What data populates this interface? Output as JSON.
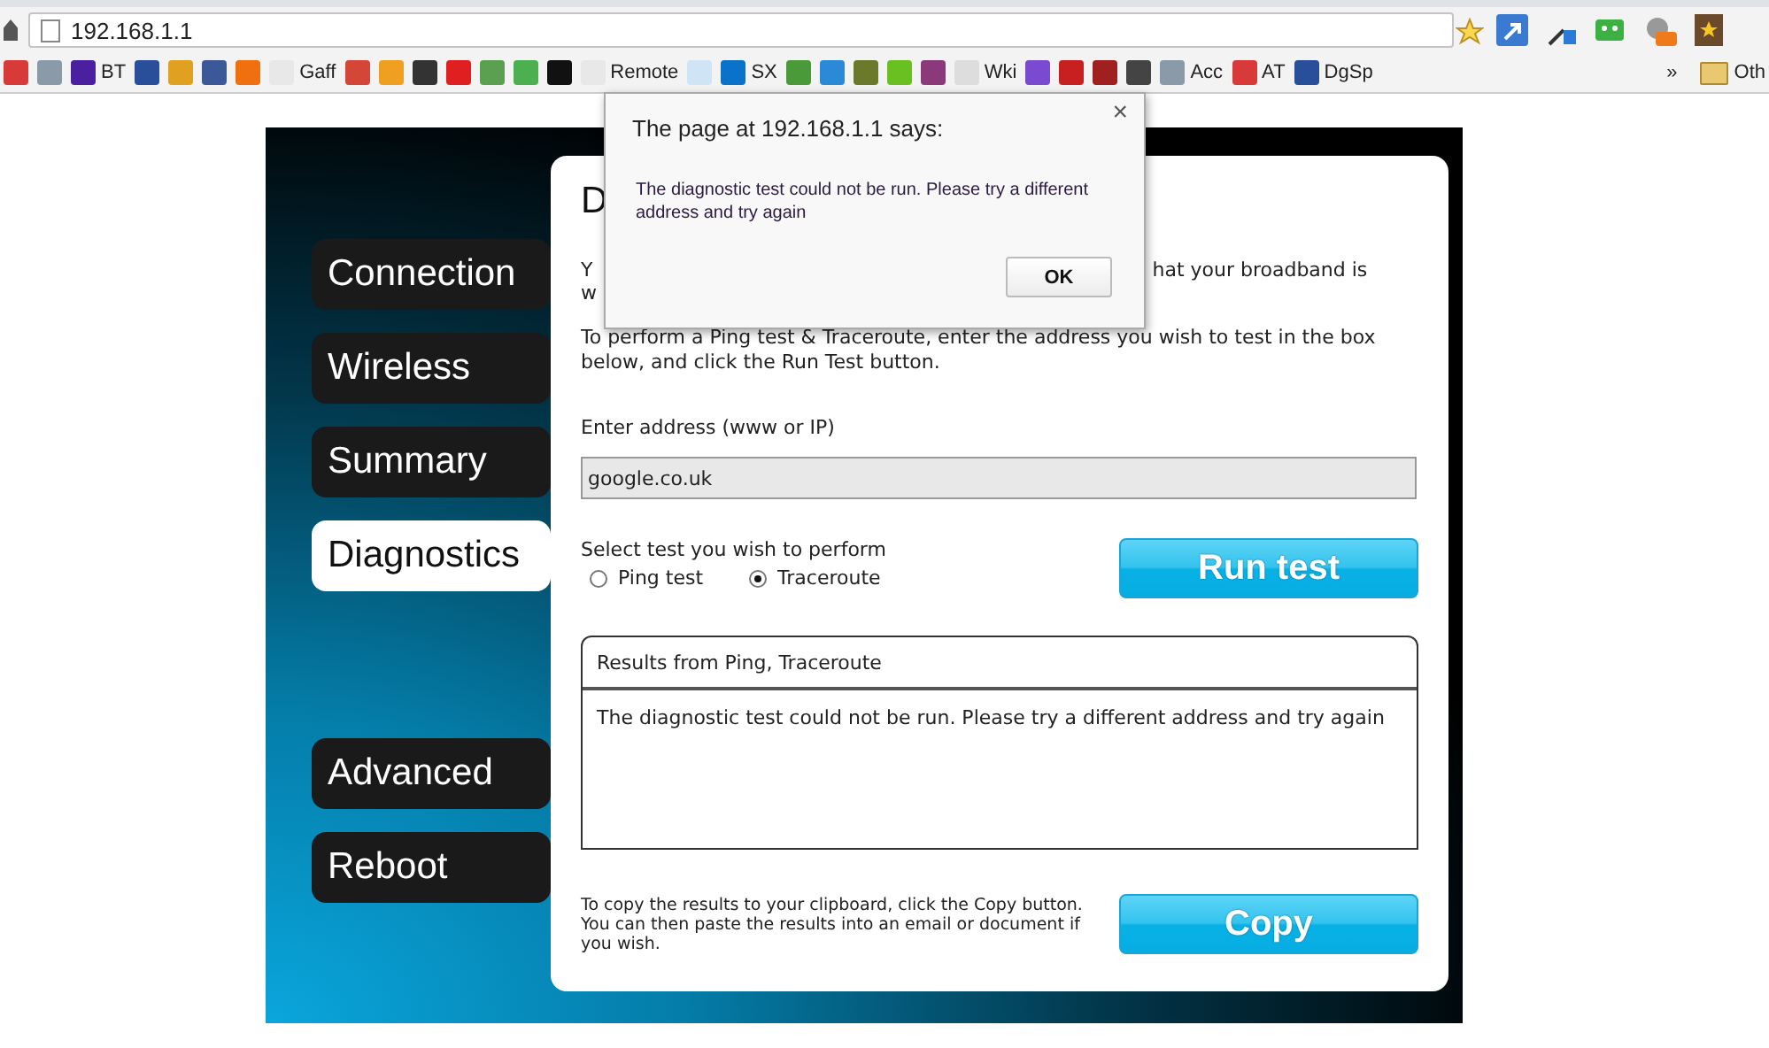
{
  "browser": {
    "address": "192.168.1.1",
    "bookmarks": [
      {
        "color": "#d83a3a"
      },
      {
        "color": "#8a9aa8"
      },
      {
        "label": "BT",
        "color": "#4a1fa0"
      },
      {
        "color": "#2a4f9a"
      },
      {
        "color": "#e0a020"
      },
      {
        "color": "#3b5998"
      },
      {
        "color": "#f07010"
      },
      {
        "label": "Gaff",
        "color": "#e8e8e8"
      },
      {
        "color": "#d44638"
      },
      {
        "color": "#f0a020"
      },
      {
        "color": "#333333"
      },
      {
        "color": "#e02020"
      },
      {
        "color": "#5aa050"
      },
      {
        "color": "#4caf50"
      },
      {
        "color": "#111111"
      },
      {
        "label": "Remote",
        "color": "#e8e8e8"
      },
      {
        "color": "#cfe4f4"
      },
      {
        "label": "SX",
        "color": "#0a72c8"
      },
      {
        "color": "#4a9a3a"
      },
      {
        "color": "#2a8ad8"
      },
      {
        "color": "#6a7a2a"
      },
      {
        "color": "#6ac020"
      },
      {
        "color": "#8a3a7a"
      },
      {
        "label": "Wki",
        "color": "#dddddd"
      },
      {
        "color": "#7a4ad0"
      },
      {
        "color": "#c82020"
      },
      {
        "color": "#a02020"
      },
      {
        "color": "#444444"
      },
      {
        "label": "Acc",
        "color": "#8a9aa8"
      },
      {
        "label": "AT",
        "color": "#d83a3a"
      },
      {
        "label": "DgSp",
        "color": "#2a4f9a"
      }
    ],
    "more": "»",
    "folder": "Oth"
  },
  "nav_top": [
    {
      "label": "Connection",
      "selected": false
    },
    {
      "label": "Wireless",
      "selected": false
    },
    {
      "label": "Summary",
      "selected": false
    },
    {
      "label": "Diagnostics",
      "selected": true
    }
  ],
  "nav_bottom": [
    {
      "label": "Advanced",
      "selected": false
    },
    {
      "label": "Reboot",
      "selected": false
    }
  ],
  "card": {
    "heading": "D",
    "intro_start": "Y",
    "intro_end": "hat your broadband is",
    "intro_line2": "w",
    "instructions": "To perform a Ping test & Traceroute, enter the address you wish to test in the box below, and click the Run Test button.",
    "address_label": "Enter address (www or IP)",
    "address_value": "google.co.uk",
    "test_label": "Select test you wish to perform",
    "tests": [
      {
        "label": "Ping test",
        "selected": false
      },
      {
        "label": "Traceroute",
        "selected": true
      }
    ],
    "run_button": "Run test",
    "results_title": "Results from Ping, Traceroute",
    "results_text": "The diagnostic test could not be run. Please try a different address and try again",
    "copy_note": "To copy the results to your clipboard, click the Copy button. You can then paste the results into an email or document if you wish.",
    "copy_button": "Copy"
  },
  "dialog": {
    "title": "The page at 192.168.1.1 says:",
    "close": "×",
    "message": "The diagnostic test could not be run. Please try a different address and try again",
    "ok": "OK"
  }
}
